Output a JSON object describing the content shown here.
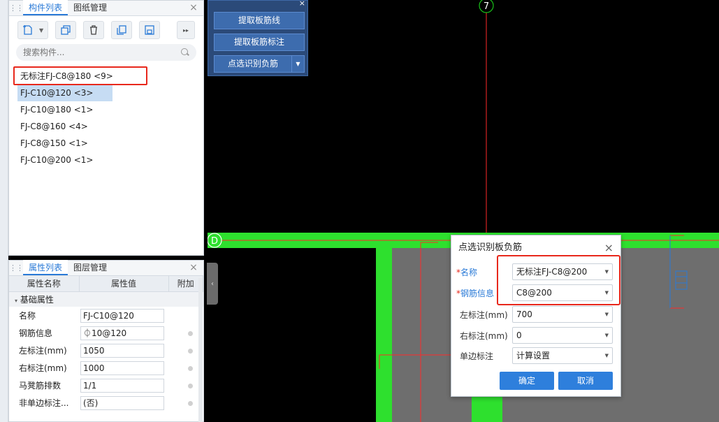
{
  "component_panel": {
    "tabs": [
      "构件列表",
      "图纸管理"
    ],
    "search_placeholder": "搜索构件...",
    "items": [
      "无标注FJ-C8@180 <9>",
      "FJ-C10@120 <3>",
      "FJ-C10@180 <1>",
      "FJ-C8@160 <4>",
      "FJ-C8@150 <1>",
      "FJ-C10@200 <1>"
    ]
  },
  "property_panel": {
    "tabs": [
      "属性列表",
      "图层管理"
    ],
    "headers": [
      "属性名称",
      "属性值",
      "附加"
    ],
    "group": "基础属性",
    "rows": [
      {
        "name": "名称",
        "value": "FJ-C10@120"
      },
      {
        "name": "钢筋信息",
        "value": "⏀10@120"
      },
      {
        "name": "左标注(mm)",
        "value": "1050"
      },
      {
        "name": "右标注(mm)",
        "value": "1000"
      },
      {
        "name": "马凳筋排数",
        "value": "1/1"
      },
      {
        "name": "非单边标注...",
        "value": "(否)"
      }
    ]
  },
  "float_toolbar": {
    "buttons": [
      "提取板筋线",
      "提取板筋标注",
      "点选识别负筋"
    ]
  },
  "canvas": {
    "axis_top": "7",
    "axis_left": "D",
    "colors": {
      "beam": "#2ee02e",
      "line": "#ff2a2a",
      "slab": "#6e6e6e",
      "axis": "#19c219"
    }
  },
  "dialog": {
    "title": "点选识别板负筋",
    "fields": [
      {
        "label": "名称",
        "required": true,
        "value": "无标注FJ-C8@200"
      },
      {
        "label": "钢筋信息",
        "required": true,
        "value": "C8@200"
      },
      {
        "label": "左标注(mm)",
        "required": false,
        "value": "700"
      },
      {
        "label": "右标注(mm)",
        "required": false,
        "value": "0"
      },
      {
        "label": "单边标注",
        "required": false,
        "value": "计算设置"
      }
    ],
    "ok_label": "确定",
    "cancel_label": "取消"
  }
}
